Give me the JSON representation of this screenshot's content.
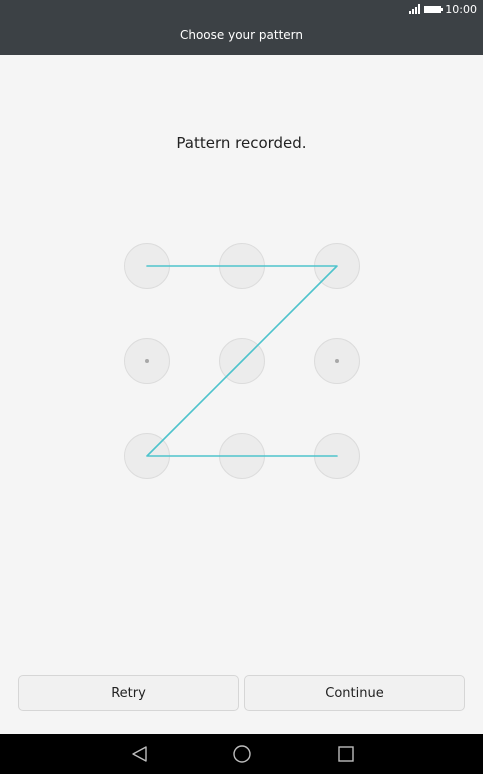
{
  "status_bar": {
    "time": "10:00",
    "signal_icon": "signal-bars-icon",
    "battery_icon": "battery-icon"
  },
  "header": {
    "title": "Choose your pattern"
  },
  "main": {
    "message": "Pattern recorded.",
    "pattern_sequence": [
      1,
      2,
      3,
      5,
      7,
      8,
      9
    ],
    "pattern_color": "#4ec3cc"
  },
  "buttons": {
    "retry_label": "Retry",
    "continue_label": "Continue"
  },
  "nav_bar": {
    "back_icon": "back-triangle-icon",
    "home_icon": "home-circle-icon",
    "recents_icon": "recents-square-icon"
  }
}
